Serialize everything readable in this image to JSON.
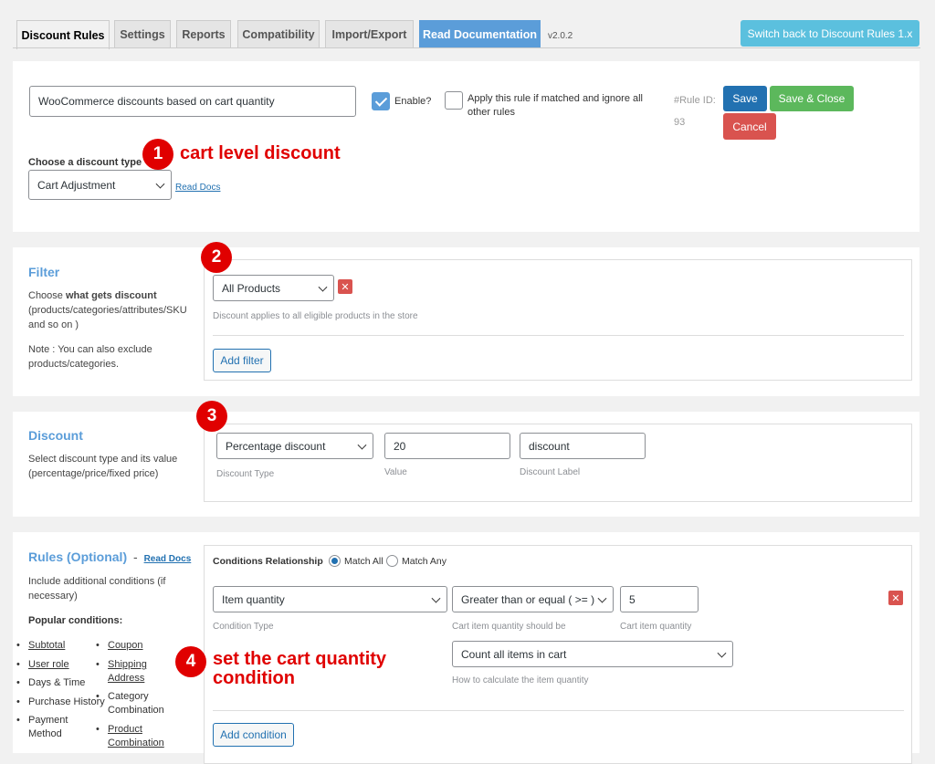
{
  "tabs": [
    {
      "label": "Discount Rules"
    },
    {
      "label": "Settings"
    },
    {
      "label": "Reports"
    },
    {
      "label": "Compatibility"
    },
    {
      "label": "Import/Export"
    },
    {
      "label": "Read Documentation"
    }
  ],
  "version": "v2.0.2",
  "switch_back_label": "Switch back to Discount Rules 1.x",
  "rule": {
    "name_value": "WooCommerce discounts based on cart quantity",
    "enable_label": "Enable?",
    "apply_label": "Apply this rule if matched and ignore all other rules",
    "rule_id_label": "#Rule ID:",
    "rule_id_value": "93",
    "save_label": "Save",
    "save_close_label": "Save & Close",
    "cancel_label": "Cancel",
    "discount_type_label": "Choose a discount type",
    "discount_type_value": "Cart Adjustment",
    "read_docs_label": "Read Docs"
  },
  "filter": {
    "title": "Filter",
    "desc_pre": "Choose ",
    "desc_bold": "what gets discount",
    "desc_post": " (products/categories/attributes/SKU and so on )",
    "note": "Note : You can also exclude products/categories.",
    "select_value": "All Products",
    "helper": "Discount applies to all eligible products in the store",
    "add_filter_label": "Add filter"
  },
  "discount": {
    "title": "Discount",
    "desc": "Select discount type and its value (percentage/price/fixed price)",
    "type_value": "Percentage discount",
    "value": "20",
    "label_value": "discount",
    "type_helper": "Discount Type",
    "value_helper": "Value",
    "label_helper": "Discount Label"
  },
  "rules": {
    "title": "Rules (Optional)",
    "dash": "-",
    "read_docs_label": "Read Docs",
    "desc": "Include additional conditions (if necessary)",
    "popular_label": "Popular conditions:",
    "popular_left": [
      "Subtotal",
      "User role",
      "Days & Time",
      "Purchase History",
      "Payment Method"
    ],
    "popular_right": [
      "Coupon",
      "Shipping Address",
      "Category Combination",
      "Product Combination"
    ],
    "relationship_label": "Conditions Relationship",
    "match_all": "Match All",
    "match_any": "Match Any",
    "condition_type_value": "Item quantity",
    "condition_type_helper": "Condition Type",
    "operator_value": "Greater than or equal ( >= )",
    "operator_helper": "Cart item quantity should be",
    "quantity_value": "5",
    "quantity_helper": "Cart item quantity",
    "calc_value": "Count all items in cart",
    "calc_helper": "How to calculate the item quantity",
    "add_condition_label": "Add condition"
  },
  "annotations": {
    "n1": "1",
    "t1": "cart level discount",
    "n2": "2",
    "n3": "3",
    "n4": "4",
    "t4a": "set the cart quantity",
    "t4b": "condition"
  },
  "icons": {
    "close": "close-icon",
    "chevron": "chevron-down-icon",
    "check": "check-icon"
  },
  "colors": {
    "accent": "#5b9dd9",
    "save": "#2271b1",
    "save_close": "#5cb85c",
    "cancel": "#d9534f",
    "annotation": "#e00000"
  }
}
